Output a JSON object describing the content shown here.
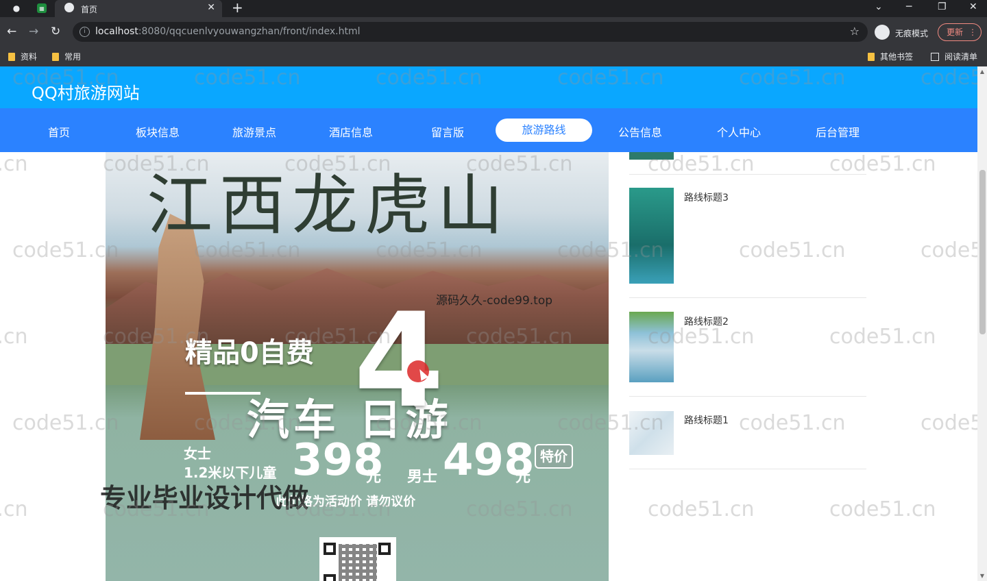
{
  "browser": {
    "tab_title": "首页",
    "new_tab_symbol": "+",
    "close_symbol": "✕",
    "url_host": "localhost",
    "url_rest": ":8080/qqcuenlvyouwangzhan/front/index.html",
    "profile_label": "无痕模式",
    "update_label": "更新",
    "bookmarks": [
      "资料",
      "常用"
    ],
    "other_bookmarks": "其他书签",
    "reading_list": "阅读清单"
  },
  "site": {
    "title": "QQ村旅游网站",
    "nav": [
      "首页",
      "板块信息",
      "旅游景点",
      "酒店信息",
      "留言版",
      "旅游路线",
      "公告信息",
      "个人中心",
      "后台管理"
    ],
    "active_nav": "旅游路线"
  },
  "poster": {
    "calligraphy": "江西龙虎山",
    "line1": "精品0自费",
    "big_number": "4",
    "line2": "汽车  日游",
    "price_female_label": "女士",
    "price_child_label": "1.2米以下儿童",
    "price_female": "398",
    "price_unit": "元",
    "price_male_label": "男士",
    "price_male": "498",
    "special_badge": "特价",
    "note": "此价格为活动价 请勿议价"
  },
  "routes": [
    {
      "title": "路线标题3",
      "thumb_color": "#1f8a80"
    },
    {
      "title": "路线标题2",
      "thumb_color": "#6fa8c4"
    },
    {
      "title": "路线标题1",
      "thumb_color": "#dfe9ef"
    }
  ],
  "overlays": {
    "source_watermark": "源码久久-code99.top",
    "biz_watermark": "专业毕业设计代做",
    "grid_watermark": "code51.cn"
  }
}
